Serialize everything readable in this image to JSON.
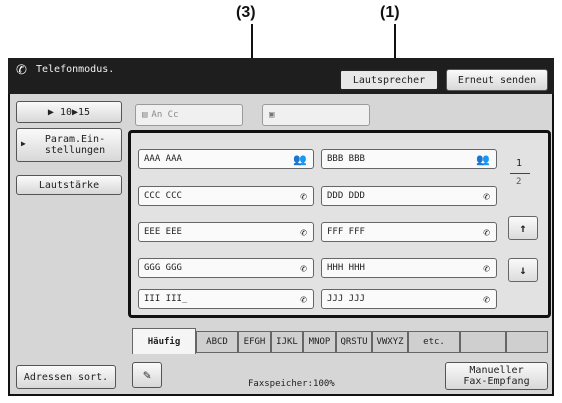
{
  "callouts": {
    "c3": "(3)",
    "c1": "(1)"
  },
  "titlebar": {
    "title": "Telefonmodus."
  },
  "top_buttons": {
    "speaker": "Lautsprecher",
    "resend": "Erneut senden"
  },
  "left": {
    "mode_btn": "▶ 10▶15",
    "param_line1": "Param.Ein-",
    "param_line2": "stellungen",
    "volume": "Lautstärke",
    "address_sort": "Adressen sort."
  },
  "slots": {
    "slot1": "An Cc"
  },
  "entries": [
    {
      "label": "AAA AAA",
      "icon": "group"
    },
    {
      "label": "BBB BBB",
      "icon": "group"
    },
    {
      "label": "CCC CCC",
      "icon": "phone"
    },
    {
      "label": "DDD DDD",
      "icon": "phone"
    },
    {
      "label": "EEE EEE",
      "icon": "phone"
    },
    {
      "label": "FFF FFF",
      "icon": "phone"
    },
    {
      "label": "GGG GGG",
      "icon": "phone"
    },
    {
      "label": "HHH HHH",
      "icon": "phone"
    },
    {
      "label": "III III_",
      "icon": "phone"
    },
    {
      "label": "JJJ JJJ",
      "icon": "phone"
    }
  ],
  "pager": {
    "current": "1",
    "total": "2"
  },
  "tabs": [
    "Häufig",
    "ABCD",
    "EFGH",
    "IJKL",
    "MNOP",
    "QRSTU",
    "VWXYZ",
    "etc."
  ],
  "bottom": {
    "fax_memory": "Faxspeicher:100%",
    "manual_line1": "Manueller",
    "manual_line2": "Fax-Empfang"
  }
}
